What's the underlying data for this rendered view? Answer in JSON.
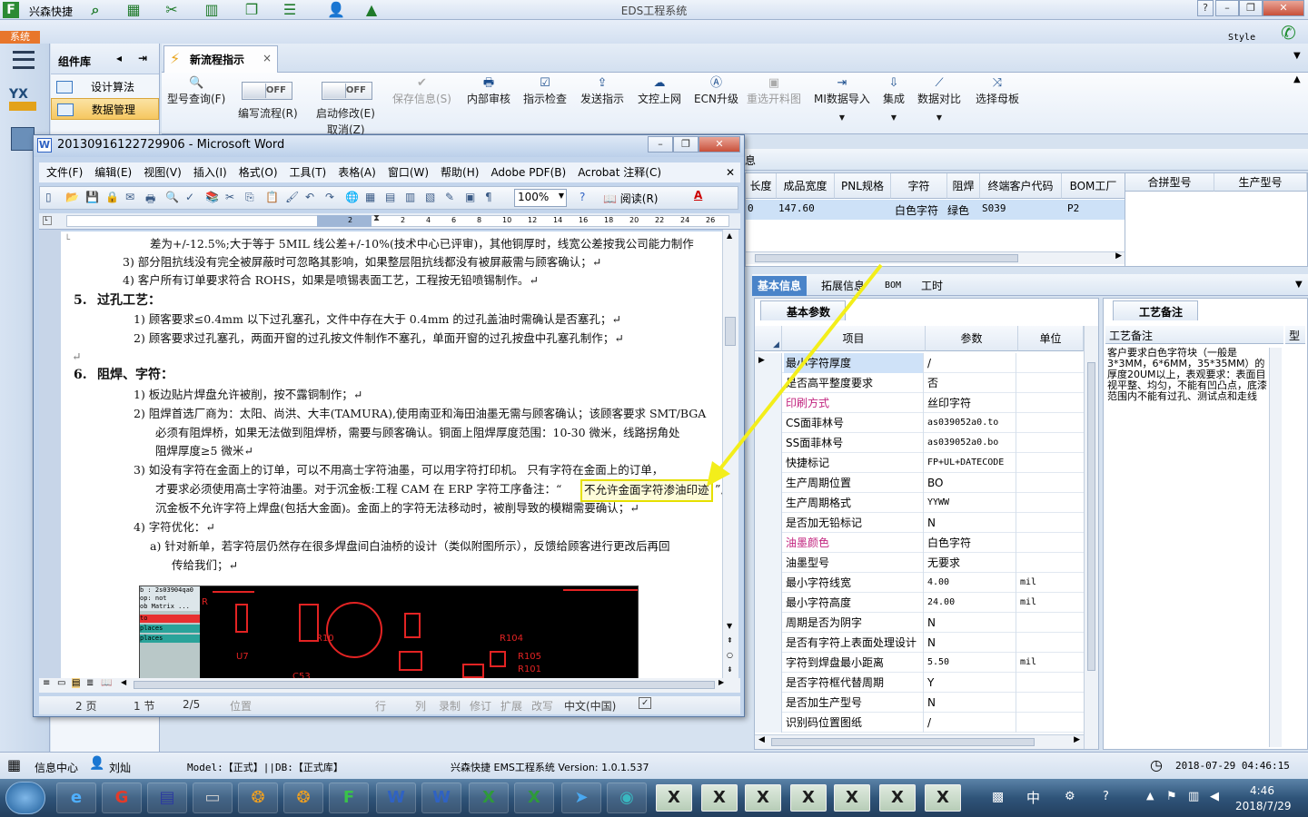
{
  "app": {
    "title": "EDS工程系统",
    "company_short": "兴森快捷",
    "style_label": "Style"
  },
  "system_tab": "系统",
  "component_library": {
    "title": "组件库",
    "items": [
      {
        "label": "设计算法",
        "selected": false
      },
      {
        "label": "数据管理",
        "selected": true
      }
    ]
  },
  "main_tab": {
    "label": "新流程指示"
  },
  "ribbon": {
    "buttons": [
      {
        "label": "型号查询(F)",
        "icon": "🔍",
        "enabled": true
      },
      {
        "label": "保存信息(S)",
        "icon": "✔",
        "enabled": false
      },
      {
        "label": "内部审核",
        "icon": "🖶",
        "enabled": true
      },
      {
        "label": "指示检查",
        "icon": "☑",
        "enabled": true
      },
      {
        "label": "发送指示",
        "icon": "⇪",
        "enabled": true
      },
      {
        "label": "文控上网",
        "icon": "☁",
        "enabled": true
      },
      {
        "label": "ECN升级",
        "icon": "Ⓐ",
        "enabled": true
      },
      {
        "label": "重选开料图",
        "icon": "▣",
        "enabled": false
      },
      {
        "label": "MI数据导入",
        "icon": "⇥",
        "enabled": true
      },
      {
        "label": "集成",
        "icon": "⇩",
        "enabled": true
      },
      {
        "label": "数据对比",
        "icon": "⟋",
        "enabled": true
      },
      {
        "label": "选择母板",
        "icon": "⤨",
        "enabled": true
      }
    ],
    "toggles": [
      {
        "label": "编写流程(R)",
        "state": "OFF"
      },
      {
        "label": "启动修改(E)",
        "state": "OFF"
      }
    ],
    "cancel_label": "取消(Z)"
  },
  "top_grid": {
    "partial_header": "息",
    "columns": [
      "长度",
      "成品宽度",
      "PNL规格",
      "字符",
      "阻焊",
      "终端客户代码",
      "BOM工厂"
    ],
    "row": {
      "长度": "0",
      "成品宽度": "147.60",
      "PNL规格": "",
      "字符": "白色字符",
      "阻焊": "绿色",
      "终端客户代码": "S039",
      "BOM工厂": "P2"
    },
    "right_columns": [
      "合拼型号",
      "生产型号"
    ]
  },
  "bottom_tabs": [
    {
      "label": "基本信息",
      "active": true
    },
    {
      "label": "拓展信息",
      "active": false
    },
    {
      "label": "BOM",
      "active": false
    },
    {
      "label": "工时",
      "active": false
    }
  ],
  "basic_params": {
    "tab_label": "基本参数",
    "headers": {
      "item": "项目",
      "param": "参数",
      "unit": "单位"
    },
    "rows": [
      {
        "item": "最小字符厚度",
        "value": "/",
        "unit": "",
        "selected": true
      },
      {
        "item": "是否高平整度要求",
        "value": "否",
        "unit": ""
      },
      {
        "item": "印刷方式",
        "value": "丝印字符",
        "unit": "",
        "highlight": true
      },
      {
        "item": "CS面菲林号",
        "value": "as039052a0.to",
        "unit": ""
      },
      {
        "item": "SS面菲林号",
        "value": "as039052a0.bo",
        "unit": ""
      },
      {
        "item": "快捷标记",
        "value": "FP+UL+DATECODE",
        "unit": ""
      },
      {
        "item": "生产周期位置",
        "value": "BO",
        "unit": ""
      },
      {
        "item": "生产周期格式",
        "value": "YYWW",
        "unit": ""
      },
      {
        "item": "是否加无铅标记",
        "value": "N",
        "unit": ""
      },
      {
        "item": "油墨颜色",
        "value": "白色字符",
        "unit": "",
        "highlight": true
      },
      {
        "item": "油墨型号",
        "value": "无要求",
        "unit": ""
      },
      {
        "item": "最小字符线宽",
        "value": "4.00",
        "unit": "mil"
      },
      {
        "item": "最小字符高度",
        "value": "24.00",
        "unit": "mil"
      },
      {
        "item": "周期是否为阴字",
        "value": "N",
        "unit": ""
      },
      {
        "item": "是否有字符上表面处理设计",
        "value": "N",
        "unit": ""
      },
      {
        "item": "字符到焊盘最小距离",
        "value": "5.50",
        "unit": "mil"
      },
      {
        "item": "是否字符框代替周期",
        "value": "Y",
        "unit": ""
      },
      {
        "item": "是否加生产型号",
        "value": "N",
        "unit": ""
      },
      {
        "item": "识别码位置图纸",
        "value": "/",
        "unit": ""
      }
    ]
  },
  "process_remark": {
    "tab_label": "工艺备注",
    "header": "工艺备注",
    "col2": "型",
    "text": "客户要求白色字符块（一般是3*3MM，6*6MM，35*35MM）的厚度20UM以上，表观要求：表面目视平整、均匀，不能有凹凸点，底漆范围内不能有过孔、测试点和走线"
  },
  "word": {
    "title": "20130916122729906 - Microsoft Word",
    "menu": [
      "文件(F)",
      "编辑(E)",
      "视图(V)",
      "插入(I)",
      "格式(O)",
      "工具(T)",
      "表格(A)",
      "窗口(W)",
      "帮助(H)",
      "Adobe PDF(B)",
      "Acrobat 注释(C)"
    ],
    "zoom": "100%",
    "reading_label": "阅读(R)",
    "ruler_marks": [
      "2",
      "2",
      "4",
      "6",
      "8",
      "10",
      "12",
      "14",
      "16",
      "18",
      "20",
      "22",
      "24",
      "26"
    ],
    "lines": [
      "差为+/-12.5%;大于等于 5MIL 线公差+/-10%(技术中心已评审)，其他铜厚时，线宽公差按我公司能力制作",
      "3) 部分阻抗线没有完全被屏蔽时可忽略其影响，如果整层阻抗线都没有被屏蔽需与顾客确认；↵",
      "4) 客户所有订单要求符合 ROHS，如果是喷锡表面工艺，工程按无铅喷锡制作。↵",
      "5.",
      "过孔工艺：",
      "1) 顾客要求≤0.4mm 以下过孔塞孔，文件中存在大于 0.4mm 的过孔盖油时需确认是否塞孔；↵",
      "2) 顾客要求过孔塞孔，两面开窗的过孔按文件制作不塞孔，单面开窗的过孔按盘中孔塞孔制作；↵",
      "6.",
      "阻焊、字符：",
      "1) 板边贴片焊盘允许被削，按不露铜制作；↵",
      "2) 阻焊首选厂商为：太阳、尚洪、大丰(TAMURA),使用南亚和海田油墨无需与顾客确认；该顾客要求 SMT/BGA",
      "必须有阻焊桥，如果无法做到阻焊桥，需要与顾客确认。铜面上阻焊厚度范围：10-30 微米，线路拐角处",
      "阻焊厚度≥5 微米↵",
      "3) 如没有字符在金面上的订单，可以不用高士字符油墨，可以用字符打印机。   只有字符在金面上的订单，",
      "才要求必须使用高士字符油墨。对于沉金板:工程 CAM 在 ERP 字符工序备注：“",
      "不允许金面字符渗油印迹",
      "”,",
      "沉金板不允许字符上焊盘(包括大金面)。金面上的字符无法移动时，被削导致的模糊需要确认；↵",
      "4) 字符优化：↵",
      "a) 针对新单，若字符层仍然存在很多焊盘间白油桥的设计（类似附图所示），反馈给顾客进行更改后再回",
      "传给我们；↵"
    ],
    "image_panel": [
      "b : 2s03904qa0",
      "op: not",
      "ob Matrix ...",
      "to",
      "places",
      "places"
    ],
    "status": {
      "page": "2 页",
      "section": "1 节",
      "pages": "2/5",
      "position": "位置",
      "row": "行",
      "col": "列",
      "rec": "录制",
      "rev": "修订",
      "ext": "扩展",
      "ovr": "改写",
      "lang": "中文(中国)"
    }
  },
  "statusbar": {
    "info_center": "信息中心",
    "user": "刘灿",
    "model": "Model:【正式】||DB:【正式库】",
    "system": "兴森快捷 EMS工程系统 Version: 1.0.1.537",
    "datetime": "2018-07-29 04:46:15"
  },
  "taskbar": {
    "time": "4:46",
    "date": "2018/7/29",
    "ime": "中"
  }
}
